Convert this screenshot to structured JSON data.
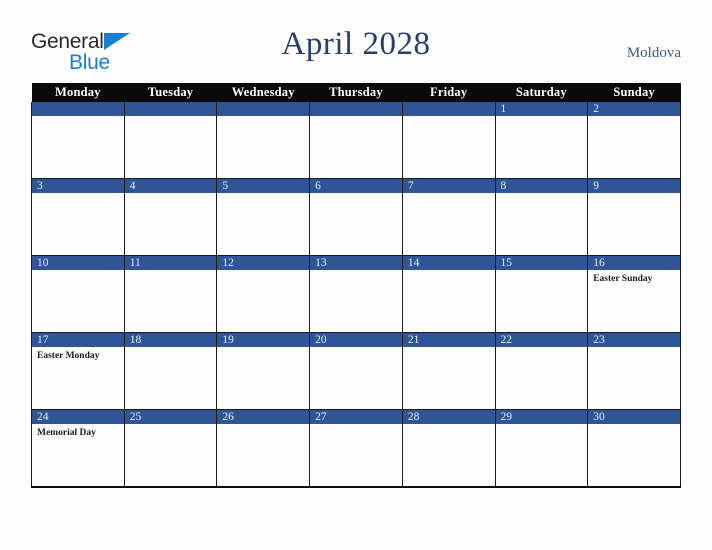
{
  "brand": {
    "name_part1": "General",
    "name_part2": "Blue",
    "triangle_icon": "blue-triangle-icon",
    "color_dark": "#2b2b2b",
    "color_blue": "#1a7fd4"
  },
  "header": {
    "title": "April 2028",
    "country": "Moldova",
    "title_color": "#26406b",
    "country_color": "#3f5c86"
  },
  "theme": {
    "accent_blue": "#2f5597",
    "header_black": "#0a0a0a",
    "page_background": "#fdfdfd",
    "border": "#1a1a1a"
  },
  "calendar": {
    "month": "April",
    "year": "2028",
    "weekday_headers": [
      "Monday",
      "Tuesday",
      "Wednesday",
      "Thursday",
      "Friday",
      "Saturday",
      "Sunday"
    ],
    "weeks": [
      [
        {
          "date": "",
          "event": ""
        },
        {
          "date": "",
          "event": ""
        },
        {
          "date": "",
          "event": ""
        },
        {
          "date": "",
          "event": ""
        },
        {
          "date": "",
          "event": ""
        },
        {
          "date": "1",
          "event": ""
        },
        {
          "date": "2",
          "event": ""
        }
      ],
      [
        {
          "date": "3",
          "event": ""
        },
        {
          "date": "4",
          "event": ""
        },
        {
          "date": "5",
          "event": ""
        },
        {
          "date": "6",
          "event": ""
        },
        {
          "date": "7",
          "event": ""
        },
        {
          "date": "8",
          "event": ""
        },
        {
          "date": "9",
          "event": ""
        }
      ],
      [
        {
          "date": "10",
          "event": ""
        },
        {
          "date": "11",
          "event": ""
        },
        {
          "date": "12",
          "event": ""
        },
        {
          "date": "13",
          "event": ""
        },
        {
          "date": "14",
          "event": ""
        },
        {
          "date": "15",
          "event": ""
        },
        {
          "date": "16",
          "event": "Easter Sunday"
        }
      ],
      [
        {
          "date": "17",
          "event": "Easter Monday"
        },
        {
          "date": "18",
          "event": ""
        },
        {
          "date": "19",
          "event": ""
        },
        {
          "date": "20",
          "event": ""
        },
        {
          "date": "21",
          "event": ""
        },
        {
          "date": "22",
          "event": ""
        },
        {
          "date": "23",
          "event": ""
        }
      ],
      [
        {
          "date": "24",
          "event": "Memorial Day"
        },
        {
          "date": "25",
          "event": ""
        },
        {
          "date": "26",
          "event": ""
        },
        {
          "date": "27",
          "event": ""
        },
        {
          "date": "28",
          "event": ""
        },
        {
          "date": "29",
          "event": ""
        },
        {
          "date": "30",
          "event": ""
        }
      ]
    ]
  }
}
